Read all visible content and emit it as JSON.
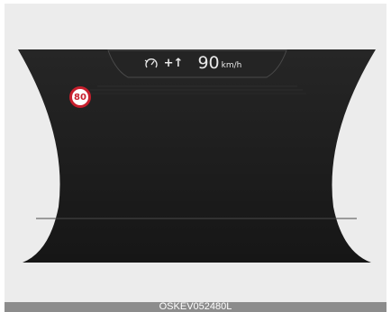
{
  "cruise_bar": {
    "limit_icon": "speed-limit-gauge-icon",
    "increment_symbol": "+↑",
    "speed_value": "90",
    "speed_unit": "km/h"
  },
  "speed_sign": {
    "value": "80",
    "border_color": "#c71f2d"
  },
  "footer": {
    "code": "OSKEV052480L"
  },
  "colors": {
    "display_background": "#1e1e1e",
    "panel_background": "#ececec",
    "text": "#e9e9e9"
  }
}
